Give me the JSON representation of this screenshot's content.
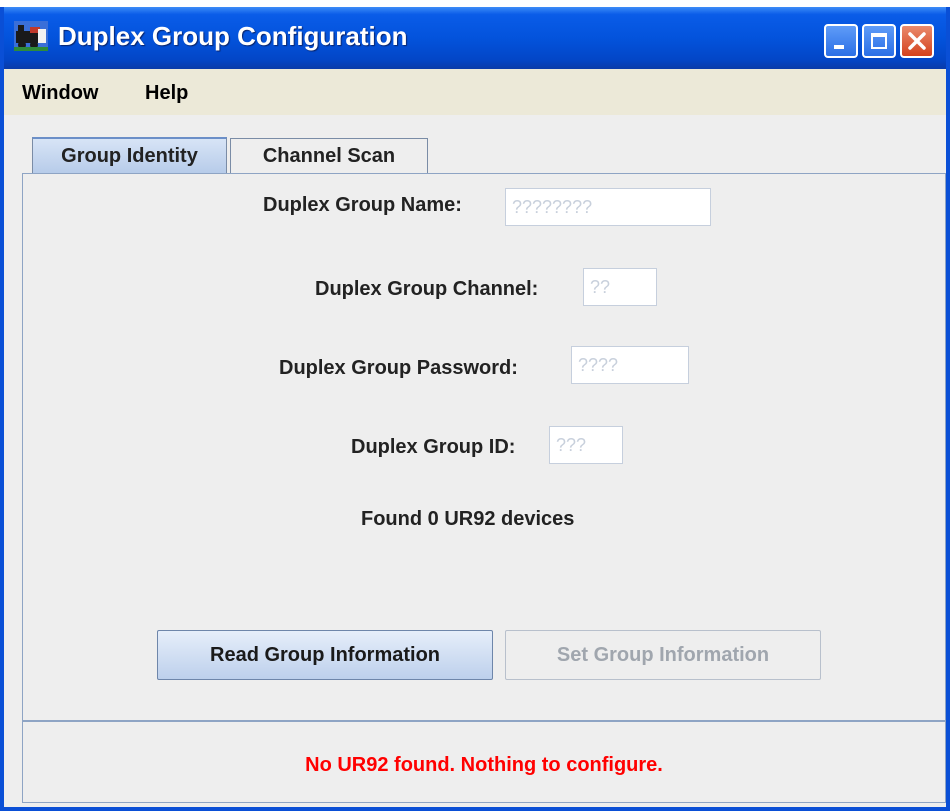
{
  "window": {
    "title": "Duplex Group Configuration"
  },
  "menu": {
    "items": [
      "Window",
      "Help"
    ]
  },
  "tabs": [
    {
      "label": "Group Identity",
      "selected": true
    },
    {
      "label": "Channel Scan",
      "selected": false
    }
  ],
  "form": {
    "name": {
      "label": "Duplex Group Name:",
      "value": "????????"
    },
    "channel": {
      "label": "Duplex Group Channel:",
      "value": "??"
    },
    "password": {
      "label": "Duplex Group Password:",
      "value": "????"
    },
    "id": {
      "label": "Duplex Group ID:",
      "value": "???"
    }
  },
  "status": "Found 0 UR92 devices",
  "buttons": {
    "read": "Read Group Information",
    "set": "Set Group Information"
  },
  "error": "No UR92 found. Nothing to configure.",
  "colors": {
    "titlebar": "#0353dc",
    "error": "#ff0000"
  }
}
